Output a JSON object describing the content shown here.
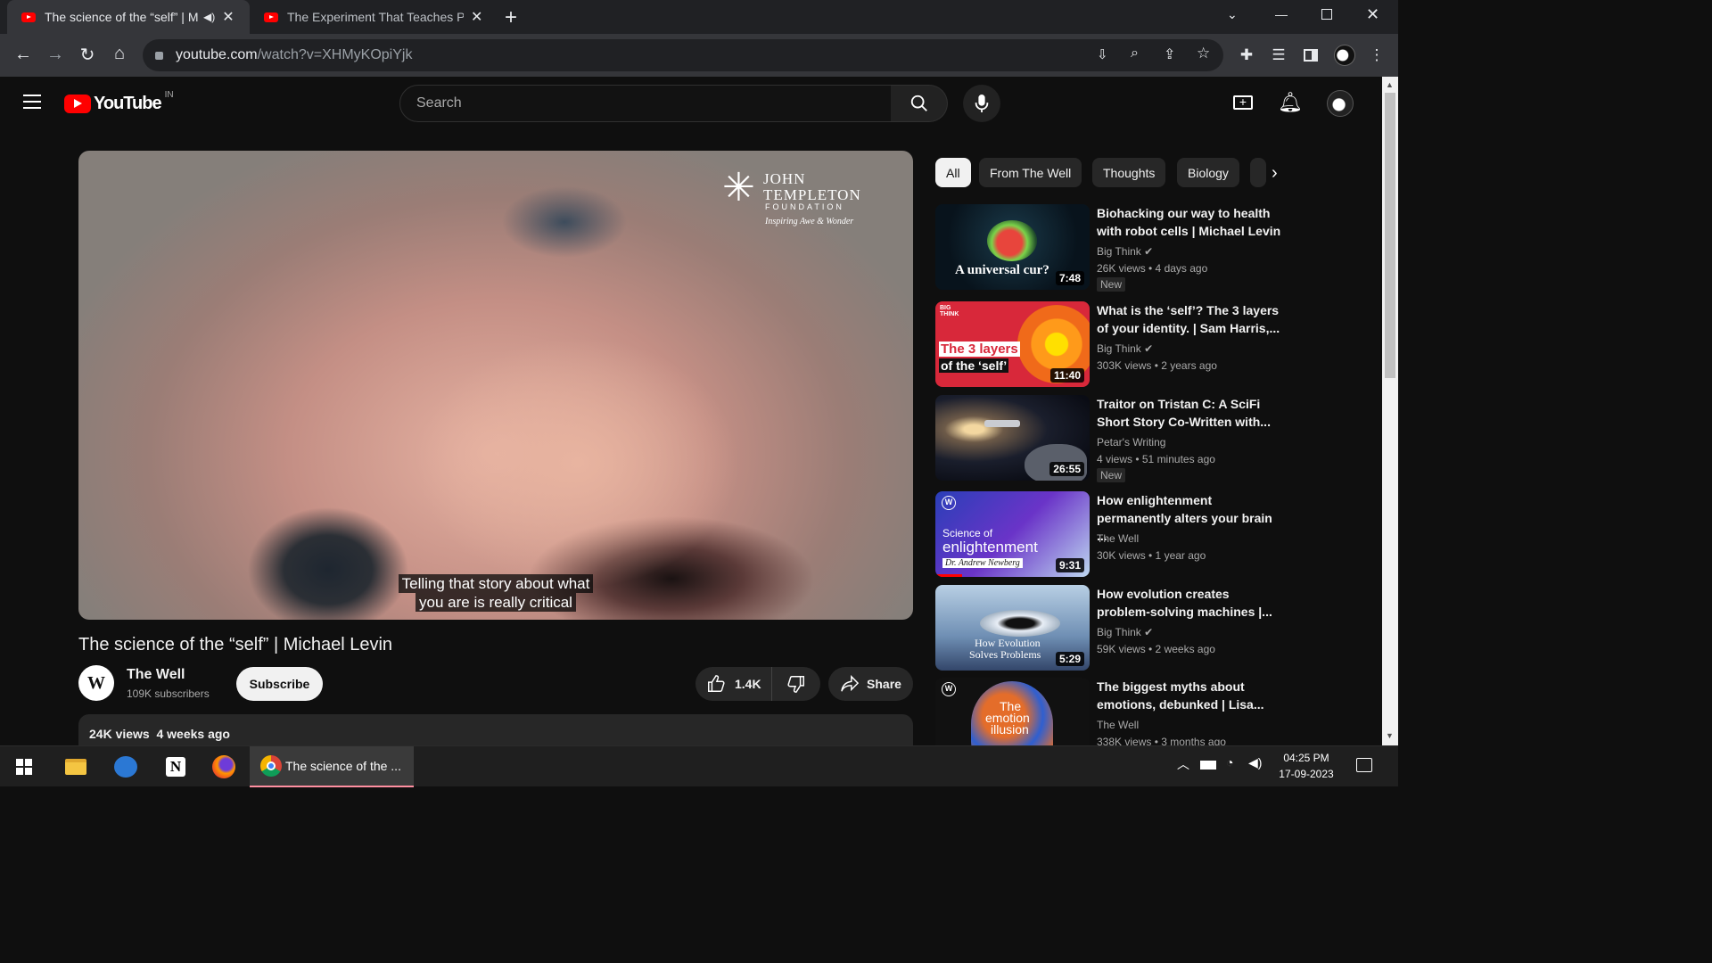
{
  "browser": {
    "tabs": [
      {
        "title": "The science of the “self” | Mi",
        "active": true
      },
      {
        "title": "The Experiment That Teaches Pec",
        "active": false
      }
    ],
    "url_host": "youtube.com",
    "url_path": "/watch?v=XHMyKOpiYjk"
  },
  "youtube": {
    "logo": "YouTube",
    "region": "IN",
    "search_placeholder": "Search",
    "video": {
      "watermark_line1": "JOHN",
      "watermark_line2": "TEMPLETON",
      "watermark_line3": "FOUNDATION",
      "watermark_line4": "Inspiring Awe & Wonder",
      "caption_line1": "Telling that story about what",
      "caption_line2": "you are is really critical",
      "title": "The science of the “self” | Michael Levin",
      "channel": "The Well",
      "channel_initial": "W",
      "subscribers": "109K subscribers",
      "subscribe_label": "Subscribe",
      "likes": "1.4K",
      "share_label": "Share",
      "views_date": "24K views  4 weeks ago"
    },
    "chips": [
      "All",
      "From The Well",
      "Thoughts",
      "Biology"
    ],
    "recommendations": [
      {
        "title": "Biohacking our way to health with robot cells | Michael Levin",
        "channel": "Big Think",
        "meta": "26K views  •  4 days ago",
        "duration": "7:48",
        "badge": "New",
        "thumb_text": "A universal cur?"
      },
      {
        "title": "What is the ‘self’? The 3 layers of your identity. | Sam Harris,...",
        "channel": "Big Think",
        "meta": "303K views  •  2 years ago",
        "duration": "11:40",
        "badge": "",
        "thumb_text": "The 3 layers",
        "thumb_text2": "of the ‘self’",
        "thumb_brand": "BIG THINK"
      },
      {
        "title": "Traitor on Tristan C: A SciFi Short Story Co-Written with...",
        "channel": "Petar's Writing",
        "meta": "4 views  •  51 minutes ago",
        "duration": "26:55",
        "badge": "New"
      },
      {
        "title": "How enlightenment permanently alters your brain ...",
        "channel": "The Well",
        "meta": "30K views  •  1 year ago",
        "duration": "9:31",
        "badge": "",
        "thumb_text": "Science of",
        "thumb_text2": "enlightenment",
        "thumb_text3": "Dr. Andrew Newberg"
      },
      {
        "title": "How evolution creates problem-solving machines |...",
        "channel": "Big Think",
        "meta": "59K views  •  2 weeks ago",
        "duration": "5:29",
        "badge": "",
        "thumb_text": "How Evolution",
        "thumb_text2": "Solves Problems"
      },
      {
        "title": "The biggest myths about emotions, debunked | Lisa...",
        "channel": "The Well",
        "meta": "338K views  •  3 months ago",
        "duration": "",
        "badge": "",
        "thumb_text": "The",
        "thumb_text2": "emotion",
        "thumb_text3": "illusion"
      }
    ]
  },
  "taskbar": {
    "active_window": "The science of the ...",
    "time": "04:25 PM",
    "date": "17-09-2023"
  },
  "colors": {
    "youtube_red": "#ff0000",
    "page_bg": "#0f0f0f",
    "chip_bg": "#272727"
  }
}
